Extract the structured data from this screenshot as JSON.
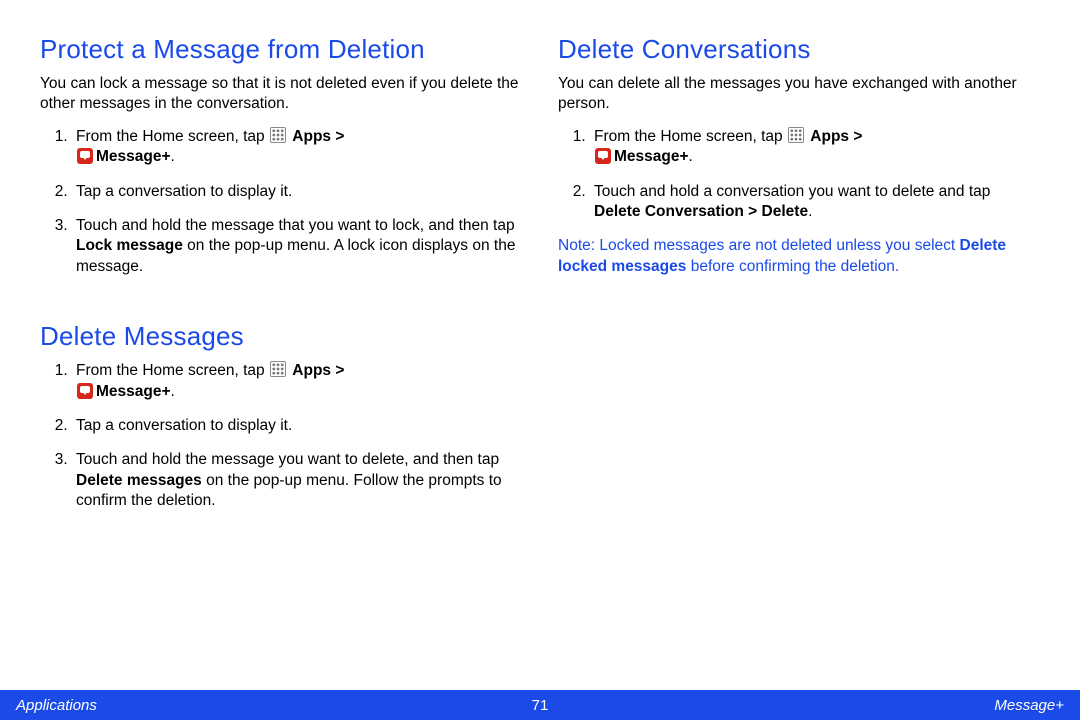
{
  "left": {
    "section1": {
      "heading": "Protect a Message from Deletion",
      "intro": "You can lock a message so that it is not deleted even if you delete the other messages in the conversation.",
      "steps": {
        "s1_pre": "From the Home screen, tap ",
        "s1_apps": "Apps > ",
        "s1_msg": "Message+",
        "s1_post": ".",
        "s2": "Tap a conversation to display it.",
        "s3_a": "Touch and hold the message that you want to lock, and then tap ",
        "s3_b": "Lock message",
        "s3_c": " on the pop-up menu. A lock icon displays on the message."
      }
    },
    "section2": {
      "heading": "Delete Messages",
      "steps": {
        "s1_pre": "From the Home screen, tap ",
        "s1_apps": "Apps > ",
        "s1_msg": "Message+",
        "s1_post": ".",
        "s2": "Tap a conversation to display it.",
        "s3_a": "Touch and hold the message you want to delete, and then tap ",
        "s3_b": "Delete messages",
        "s3_c": " on the pop-up menu. Follow the prompts to confirm the deletion."
      }
    }
  },
  "right": {
    "section1": {
      "heading": "Delete Conversations",
      "intro": "You can delete all the messages you have exchanged with another person.",
      "steps": {
        "s1_pre": "From the Home screen, tap ",
        "s1_apps": "Apps > ",
        "s1_msg": "Message+",
        "s1_post": ".",
        "s2_a": "Touch and hold a conversation you want to delete and tap ",
        "s2_b": "Delete Conversation > Delete",
        "s2_c": "."
      },
      "note": {
        "label": "Note",
        "a": ": Locked messages are not deleted unless you select ",
        "b": "Delete locked messages",
        "c": " before confirming the deletion."
      }
    }
  },
  "footer": {
    "left": "Applications",
    "center": "71",
    "right": "Message+"
  }
}
